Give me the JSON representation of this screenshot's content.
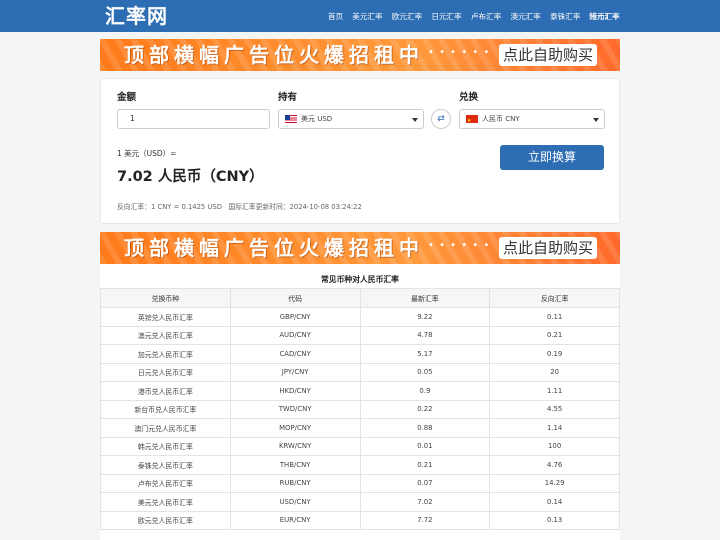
{
  "header": {
    "logo": "汇率网",
    "nav": [
      "首页",
      "美元汇率",
      "欧元汇率",
      "日元汇率",
      "卢布汇率",
      "澳元汇率",
      "泰铢汇率",
      "港币汇率"
    ],
    "nav_last": "韩元汇率"
  },
  "banner": {
    "text": "顶部横幅广告位火爆招租中",
    "dots": "• • • • • •",
    "button": "点此自助购买"
  },
  "converter": {
    "amount_label": "金额",
    "amount_value": "1",
    "hold_label": "持有",
    "hold_value": "美元 USD",
    "convert_label": "兑换",
    "convert_value": "人民币 CNY",
    "swap_icon": "⇄",
    "result_line1": "1 美元（USD）=",
    "result_line2": "7.02 人民币（CNY）",
    "reverse_rate": "反向汇率：1 CNY = 0.1425 USD",
    "update_time": "国际汇率更新时间：2024-10-08 03:24:22",
    "button": "立即换算"
  },
  "table": {
    "title": "常见币种对人民币汇率",
    "headers": [
      "兑换币种",
      "代码",
      "最新汇率",
      "反向汇率"
    ],
    "rows": [
      [
        "英镑兑人民币汇率",
        "GBP/CNY",
        "9.22",
        "0.11"
      ],
      [
        "澳元兑人民币汇率",
        "AUD/CNY",
        "4.78",
        "0.21"
      ],
      [
        "加元兑人民币汇率",
        "CAD/CNY",
        "5.17",
        "0.19"
      ],
      [
        "日元兑人民币汇率",
        "JPY/CNY",
        "0.05",
        "20"
      ],
      [
        "港币兑人民币汇率",
        "HKD/CNY",
        "0.9",
        "1.11"
      ],
      [
        "新台币兑人民币汇率",
        "TWD/CNY",
        "0.22",
        "4.55"
      ],
      [
        "澳门元兑人民币汇率",
        "MOP/CNY",
        "0.88",
        "1.14"
      ],
      [
        "韩元兑人民币汇率",
        "KRW/CNY",
        "0.01",
        "100"
      ],
      [
        "泰铢兑人民币汇率",
        "THB/CNY",
        "0.21",
        "4.76"
      ],
      [
        "卢布兑人民币汇率",
        "RUB/CNY",
        "0.07",
        "14.29"
      ],
      [
        "美元兑人民币汇率",
        "USD/CNY",
        "7.02",
        "0.14"
      ],
      [
        "欧元兑人民币汇率",
        "EUR/CNY",
        "7.72",
        "0.13"
      ]
    ]
  },
  "colors": {
    "header_bg": "#2c6db3",
    "button_bg": "#2c6db3",
    "banner_orange": "#ff8a2a"
  }
}
